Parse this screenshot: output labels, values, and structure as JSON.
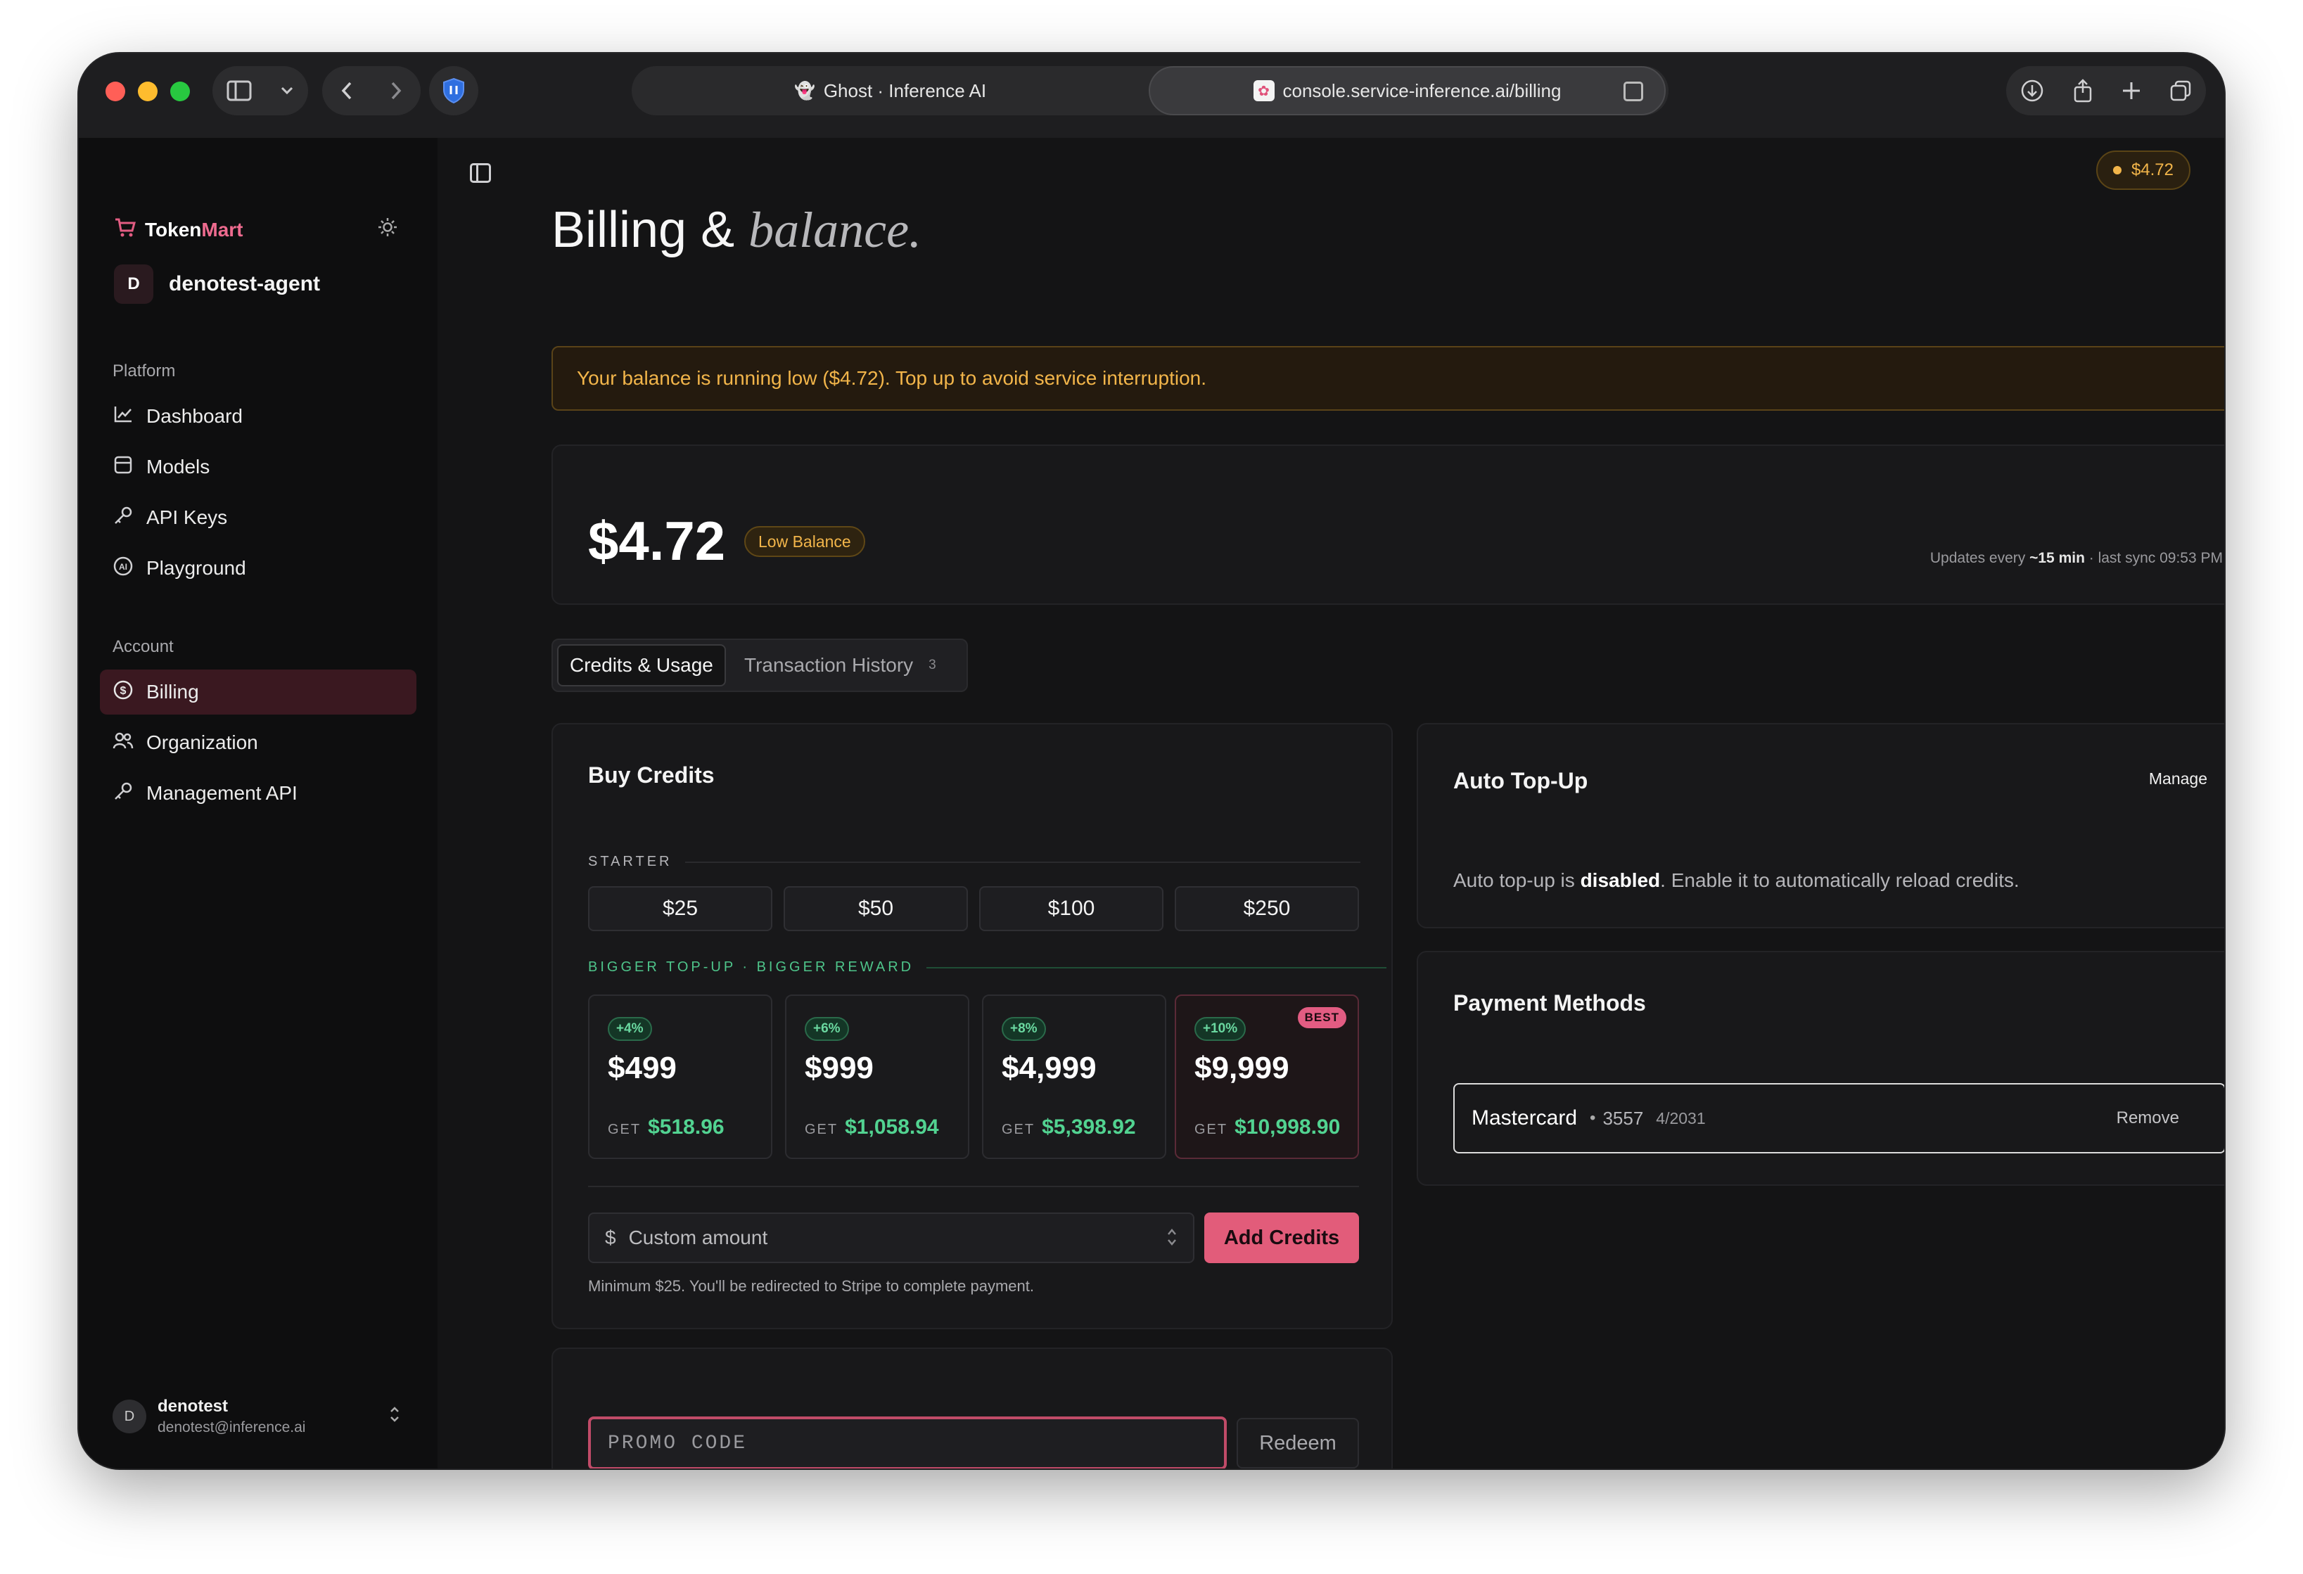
{
  "browser": {
    "tabs": [
      {
        "title": "Ghost · Inference AI",
        "favicon": "ghost-icon"
      },
      {
        "title": "console.service-inference.ai/billing",
        "favicon": "tokenmart-favicon"
      }
    ]
  },
  "sidebar": {
    "brand": {
      "part1": "Token",
      "part2": "Mart"
    },
    "org": {
      "initial": "D",
      "name": "denotest-agent"
    },
    "platform_label": "Platform",
    "platform_items": [
      {
        "label": "Dashboard",
        "icon": "chart-line-icon"
      },
      {
        "label": "Models",
        "icon": "cube-icon"
      },
      {
        "label": "API Keys",
        "icon": "key-icon"
      },
      {
        "label": "Playground",
        "icon": "ai-icon"
      }
    ],
    "account_label": "Account",
    "account_items": [
      {
        "label": "Billing",
        "icon": "dollar-circle-icon",
        "active": true
      },
      {
        "label": "Organization",
        "icon": "users-icon"
      },
      {
        "label": "Management API",
        "icon": "key-icon"
      }
    ],
    "user": {
      "initial": "D",
      "name": "denotest",
      "email": "denotest@inference.ai"
    }
  },
  "header": {
    "balance_chip": "$4.72",
    "title_main": "Billing &",
    "title_em": "balance."
  },
  "alert": {
    "text": "Your balance is running low ($4.72). Top up to avoid service interruption."
  },
  "balance": {
    "amount": "$4.72",
    "badge": "Low Balance",
    "sync_prefix": "Updates every",
    "sync_interval": "~15 min",
    "sync_suffix": "· last sync 09:53 PM"
  },
  "tabs": {
    "credits": "Credits & Usage",
    "history": "Transaction History",
    "history_count": "3"
  },
  "buy_credits": {
    "title": "Buy Credits",
    "starter_label": "STARTER",
    "starter_amounts": [
      "$25",
      "$50",
      "$100",
      "$250"
    ],
    "bonus_label": "BIGGER TOP-UP · BIGGER REWARD",
    "bonus_tiers": [
      {
        "pct": "+4%",
        "price": "$499",
        "get_label": "GET",
        "get": "$518.96"
      },
      {
        "pct": "+6%",
        "price": "$999",
        "get_label": "GET",
        "get": "$1,058.94"
      },
      {
        "pct": "+8%",
        "price": "$4,999",
        "get_label": "GET",
        "get": "$5,398.92"
      },
      {
        "pct": "+10%",
        "price": "$9,999",
        "get_label": "GET",
        "get": "$10,998.90",
        "badge": "BEST"
      }
    ],
    "currency_symbol": "$",
    "custom_placeholder": "Custom amount",
    "add_button": "Add Credits",
    "hint": "Minimum $25. You'll be redirected to Stripe to complete payment."
  },
  "promo": {
    "placeholder": "PROMO CODE",
    "redeem": "Redeem"
  },
  "auto_topup": {
    "title": "Auto Top-Up",
    "manage": "Manage",
    "text_before": "Auto top-up is",
    "status": "disabled",
    "text_after": ". Enable it to automatically reload credits."
  },
  "payment_methods": {
    "title": "Payment Methods",
    "card": {
      "brand": "Mastercard",
      "last4": "3557",
      "expiry": "4/2031",
      "remove": "Remove"
    }
  },
  "colors": {
    "accent": "#e25c7a",
    "warning": "#f2b54a",
    "success": "#52d391",
    "background": "#141415"
  }
}
